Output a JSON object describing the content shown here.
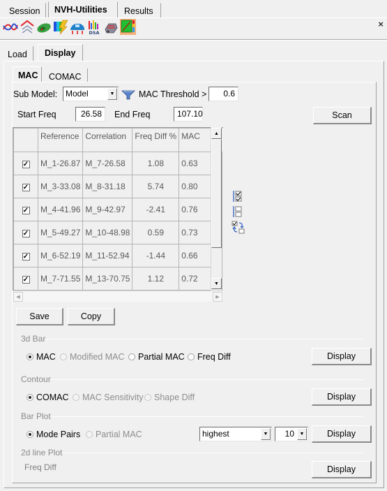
{
  "top_tabs": [
    {
      "label": "Session",
      "active": false
    },
    {
      "label": "NVH-Utilities",
      "active": true
    },
    {
      "label": "Results",
      "active": false
    }
  ],
  "toolbar": {
    "icons": [
      "frf-curves-icon",
      "mode-shapes-icon",
      "green-model-icon",
      "energy-contour-icon",
      "vehicle-loads-icon",
      "dsa-icon",
      "engine-mount-icon",
      "mac-matrix-icon"
    ],
    "dsa_text": "DSA",
    "close_label": "×"
  },
  "sub_tabs": [
    {
      "label": "Load",
      "active": false
    },
    {
      "label": "Display",
      "active": true
    }
  ],
  "inner_tabs": [
    {
      "label": "MAC",
      "active": true
    },
    {
      "label": "COMAC",
      "active": false
    }
  ],
  "filters": {
    "sub_model_label": "Sub Model:",
    "sub_model_value": "Model",
    "mac_threshold_label": "MAC Threshold >",
    "mac_threshold_value": "0.6",
    "start_freq_label": "Start Freq",
    "start_freq_value": "26.58",
    "end_freq_label": "End Freq",
    "end_freq_value": "107.10",
    "scan_label": "Scan"
  },
  "table": {
    "columns": [
      "",
      "Reference",
      "Correlation",
      "Freq Diff %",
      "MAC",
      "»"
    ],
    "rows": [
      {
        "checked": true,
        "reference": "M_1-26.87",
        "correlation": "M_7-26.58",
        "freq_diff": "1.08",
        "mac": "0.63"
      },
      {
        "checked": true,
        "reference": "M_3-33.08",
        "correlation": "M_8-31.18",
        "freq_diff": "5.74",
        "mac": "0.80"
      },
      {
        "checked": true,
        "reference": "M_4-41.96",
        "correlation": "M_9-42.97",
        "freq_diff": "-2.41",
        "mac": "0.76"
      },
      {
        "checked": true,
        "reference": "M_5-49.27",
        "correlation": "M_10-48.98",
        "freq_diff": "0.59",
        "mac": "0.73"
      },
      {
        "checked": true,
        "reference": "M_6-52.19",
        "correlation": "M_11-52.94",
        "freq_diff": "-1.44",
        "mac": "0.66"
      },
      {
        "checked": true,
        "reference": "M_7-71.55",
        "correlation": "M_13-70.75",
        "freq_diff": "1.12",
        "mac": "0.72"
      }
    ],
    "side_icons": [
      "check-all-icon",
      "uncheck-all-icon",
      "invert-selection-icon"
    ]
  },
  "actions": {
    "save_label": "Save",
    "copy_label": "Copy"
  },
  "bar3d": {
    "title": "3d Bar",
    "options": [
      {
        "label": "MAC",
        "selected": true,
        "enabled": true
      },
      {
        "label": "Modified MAC",
        "selected": false,
        "enabled": false
      },
      {
        "label": "Partial MAC",
        "selected": false,
        "enabled": true
      },
      {
        "label": "Freq Diff",
        "selected": false,
        "enabled": true
      }
    ],
    "display_label": "Display"
  },
  "contour": {
    "title": "Contour",
    "options": [
      {
        "label": "COMAC",
        "selected": true,
        "enabled": true
      },
      {
        "label": "MAC Sensitivity",
        "selected": false,
        "enabled": false
      },
      {
        "label": "Shape Diff",
        "selected": false,
        "enabled": false
      }
    ],
    "display_label": "Display"
  },
  "bar_plot": {
    "title": "Bar Plot",
    "options": [
      {
        "label": "Mode Pairs",
        "selected": true,
        "enabled": true
      },
      {
        "label": "Partial MAC",
        "selected": false,
        "enabled": false
      }
    ],
    "order_value": "highest",
    "count_value": "10",
    "display_label": "Display"
  },
  "line2d": {
    "title": "2d line Plot",
    "label": "Freq Diff",
    "display_label": "Display"
  }
}
